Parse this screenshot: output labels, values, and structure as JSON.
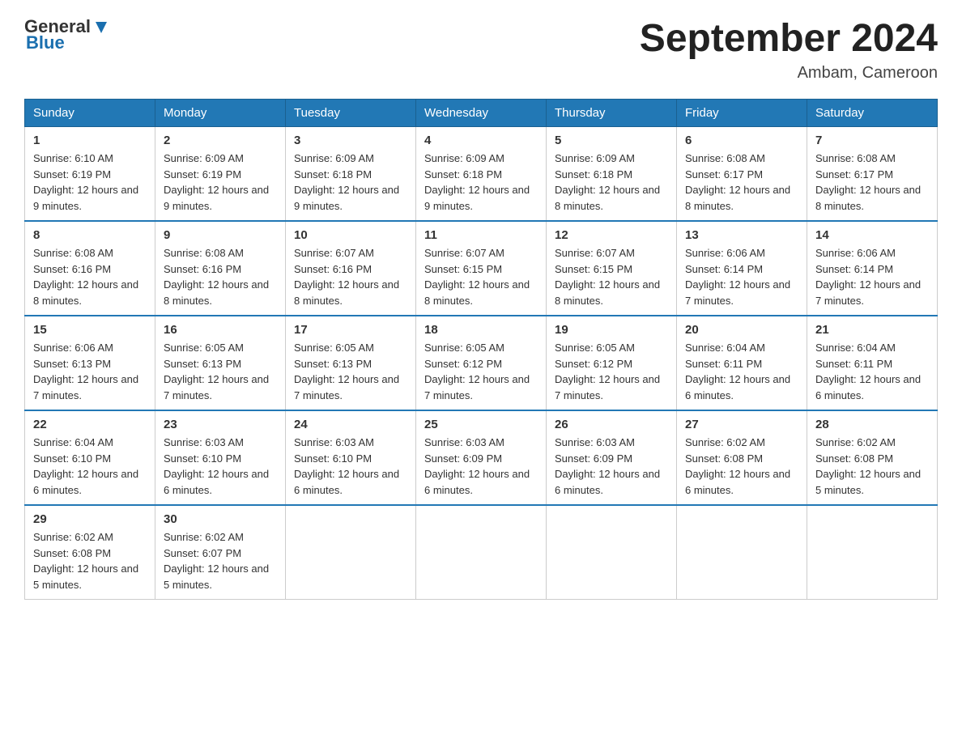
{
  "header": {
    "logo": {
      "general": "General",
      "blue": "Blue"
    },
    "title": "September 2024",
    "location": "Ambam, Cameroon"
  },
  "days_of_week": [
    "Sunday",
    "Monday",
    "Tuesday",
    "Wednesday",
    "Thursday",
    "Friday",
    "Saturday"
  ],
  "weeks": [
    [
      {
        "day": "1",
        "sunrise": "6:10 AM",
        "sunset": "6:19 PM",
        "daylight": "12 hours and 9 minutes."
      },
      {
        "day": "2",
        "sunrise": "6:09 AM",
        "sunset": "6:19 PM",
        "daylight": "12 hours and 9 minutes."
      },
      {
        "day": "3",
        "sunrise": "6:09 AM",
        "sunset": "6:18 PM",
        "daylight": "12 hours and 9 minutes."
      },
      {
        "day": "4",
        "sunrise": "6:09 AM",
        "sunset": "6:18 PM",
        "daylight": "12 hours and 9 minutes."
      },
      {
        "day": "5",
        "sunrise": "6:09 AM",
        "sunset": "6:18 PM",
        "daylight": "12 hours and 8 minutes."
      },
      {
        "day": "6",
        "sunrise": "6:08 AM",
        "sunset": "6:17 PM",
        "daylight": "12 hours and 8 minutes."
      },
      {
        "day": "7",
        "sunrise": "6:08 AM",
        "sunset": "6:17 PM",
        "daylight": "12 hours and 8 minutes."
      }
    ],
    [
      {
        "day": "8",
        "sunrise": "6:08 AM",
        "sunset": "6:16 PM",
        "daylight": "12 hours and 8 minutes."
      },
      {
        "day": "9",
        "sunrise": "6:08 AM",
        "sunset": "6:16 PM",
        "daylight": "12 hours and 8 minutes."
      },
      {
        "day": "10",
        "sunrise": "6:07 AM",
        "sunset": "6:16 PM",
        "daylight": "12 hours and 8 minutes."
      },
      {
        "day": "11",
        "sunrise": "6:07 AM",
        "sunset": "6:15 PM",
        "daylight": "12 hours and 8 minutes."
      },
      {
        "day": "12",
        "sunrise": "6:07 AM",
        "sunset": "6:15 PM",
        "daylight": "12 hours and 8 minutes."
      },
      {
        "day": "13",
        "sunrise": "6:06 AM",
        "sunset": "6:14 PM",
        "daylight": "12 hours and 7 minutes."
      },
      {
        "day": "14",
        "sunrise": "6:06 AM",
        "sunset": "6:14 PM",
        "daylight": "12 hours and 7 minutes."
      }
    ],
    [
      {
        "day": "15",
        "sunrise": "6:06 AM",
        "sunset": "6:13 PM",
        "daylight": "12 hours and 7 minutes."
      },
      {
        "day": "16",
        "sunrise": "6:05 AM",
        "sunset": "6:13 PM",
        "daylight": "12 hours and 7 minutes."
      },
      {
        "day": "17",
        "sunrise": "6:05 AM",
        "sunset": "6:13 PM",
        "daylight": "12 hours and 7 minutes."
      },
      {
        "day": "18",
        "sunrise": "6:05 AM",
        "sunset": "6:12 PM",
        "daylight": "12 hours and 7 minutes."
      },
      {
        "day": "19",
        "sunrise": "6:05 AM",
        "sunset": "6:12 PM",
        "daylight": "12 hours and 7 minutes."
      },
      {
        "day": "20",
        "sunrise": "6:04 AM",
        "sunset": "6:11 PM",
        "daylight": "12 hours and 6 minutes."
      },
      {
        "day": "21",
        "sunrise": "6:04 AM",
        "sunset": "6:11 PM",
        "daylight": "12 hours and 6 minutes."
      }
    ],
    [
      {
        "day": "22",
        "sunrise": "6:04 AM",
        "sunset": "6:10 PM",
        "daylight": "12 hours and 6 minutes."
      },
      {
        "day": "23",
        "sunrise": "6:03 AM",
        "sunset": "6:10 PM",
        "daylight": "12 hours and 6 minutes."
      },
      {
        "day": "24",
        "sunrise": "6:03 AM",
        "sunset": "6:10 PM",
        "daylight": "12 hours and 6 minutes."
      },
      {
        "day": "25",
        "sunrise": "6:03 AM",
        "sunset": "6:09 PM",
        "daylight": "12 hours and 6 minutes."
      },
      {
        "day": "26",
        "sunrise": "6:03 AM",
        "sunset": "6:09 PM",
        "daylight": "12 hours and 6 minutes."
      },
      {
        "day": "27",
        "sunrise": "6:02 AM",
        "sunset": "6:08 PM",
        "daylight": "12 hours and 6 minutes."
      },
      {
        "day": "28",
        "sunrise": "6:02 AM",
        "sunset": "6:08 PM",
        "daylight": "12 hours and 5 minutes."
      }
    ],
    [
      {
        "day": "29",
        "sunrise": "6:02 AM",
        "sunset": "6:08 PM",
        "daylight": "12 hours and 5 minutes."
      },
      {
        "day": "30",
        "sunrise": "6:02 AM",
        "sunset": "6:07 PM",
        "daylight": "12 hours and 5 minutes."
      },
      null,
      null,
      null,
      null,
      null
    ]
  ]
}
